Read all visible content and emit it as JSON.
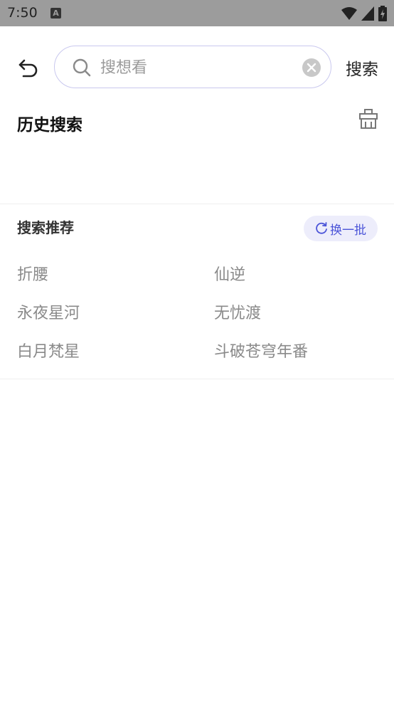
{
  "status_bar": {
    "time": "7:50",
    "notification_icon": "A"
  },
  "search": {
    "placeholder": "搜想看",
    "value": "",
    "submit_label": "搜索"
  },
  "history": {
    "title": "历史搜索",
    "items": []
  },
  "recommend": {
    "title": "搜索推荐",
    "refresh_label": "换一批",
    "items": [
      "折腰",
      "仙逆",
      "永夜星河",
      "无忧渡",
      "白月梵星",
      "斗破苍穹年番"
    ]
  },
  "colors": {
    "accent": "#4b54d8",
    "accent_bg": "#ededfb",
    "search_border": "#c9c8ee",
    "status_bar": "#9c9c9c"
  }
}
